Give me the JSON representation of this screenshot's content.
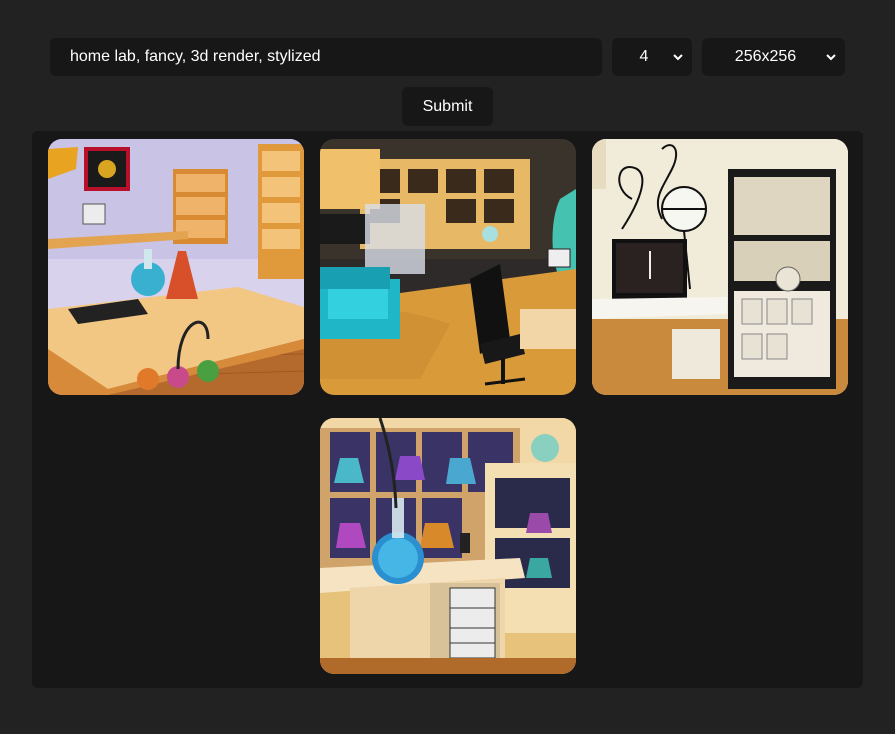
{
  "prompt": {
    "value": "home lab, fancy, 3d render, stylized"
  },
  "count_select": {
    "value": "4"
  },
  "size_select": {
    "value": "256x256"
  },
  "submit": {
    "label": "Submit"
  },
  "gallery": {
    "images": [
      {
        "name": "generated-image-1"
      },
      {
        "name": "generated-image-2"
      },
      {
        "name": "generated-image-3"
      },
      {
        "name": "generated-image-4"
      }
    ]
  }
}
